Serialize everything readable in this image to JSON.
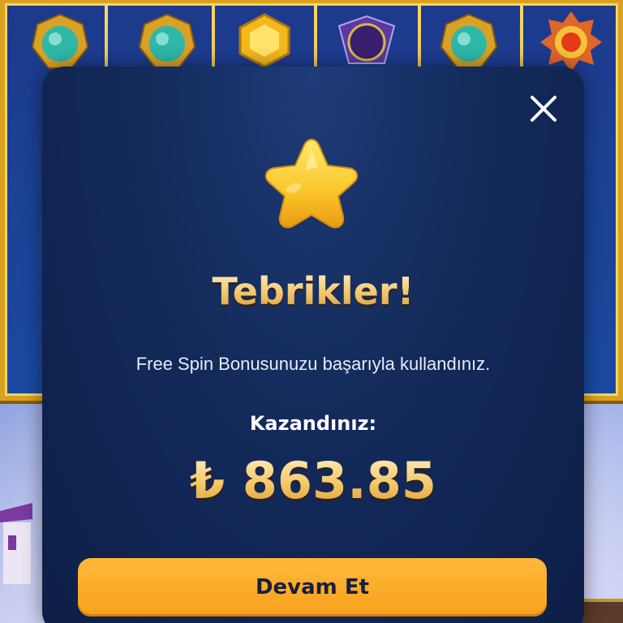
{
  "background": {
    "symbols_row1": [
      "teal-gem-icon",
      "teal-gem-icon",
      "yellow-gem-icon",
      "moon-amulet-icon",
      "teal-gem-icon",
      "sun-amulet-icon"
    ]
  },
  "modal": {
    "icon": "star-icon",
    "title": "Tebrikler!",
    "message": "Free Spin Bonusunuzu başarıyla kullandınız.",
    "won_label": "Kazandınız:",
    "amount": "₺ 863.85",
    "continue_button": "Devam Et",
    "close_icon": "close-icon"
  },
  "colors": {
    "modal_bg": "#132a5a",
    "title_gold": "#f2c66a",
    "button_orange": "#f7a11c",
    "button_text": "#1a1f3a"
  }
}
